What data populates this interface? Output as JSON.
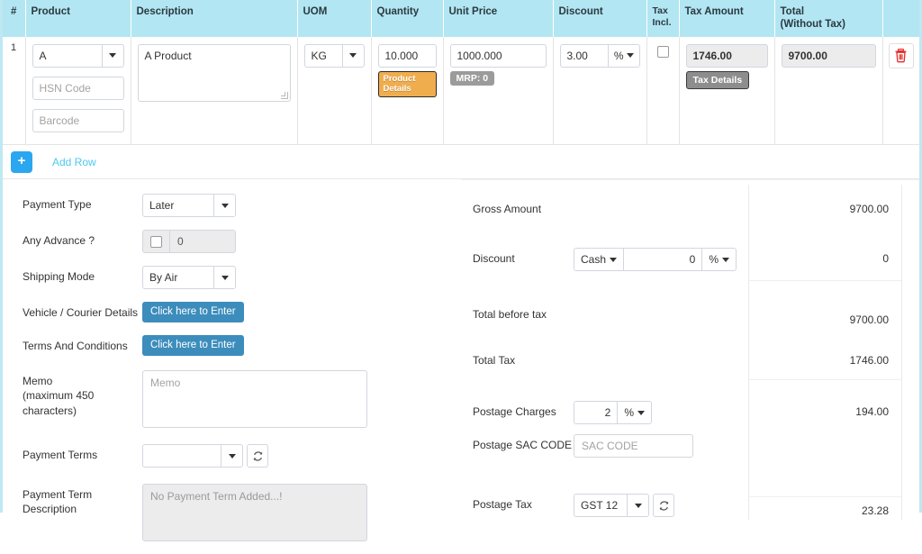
{
  "items_table": {
    "columns": [
      "#",
      "Product",
      "Description",
      "UOM",
      "Quantity",
      "Unit Price",
      "Discount",
      "Tax Incl.",
      "Tax Amount",
      "Total (Without Tax)",
      ""
    ],
    "headers": {
      "index": "#",
      "product": "Product",
      "description": "Description",
      "uom": "UOM",
      "quantity": "Quantity",
      "unit_price": "Unit Price",
      "discount": "Discount",
      "tax_incl_line1": "Tax",
      "tax_incl_line2": "Incl.",
      "tax_amount": "Tax Amount",
      "total_line1": "Total",
      "total_line2": "(Without Tax)"
    },
    "row": {
      "index": "1",
      "product_value": "A",
      "hsn_placeholder": "HSN Code",
      "barcode_placeholder": "Barcode",
      "description_value": "A Product",
      "uom_value": "KG",
      "quantity_value": "10.000",
      "product_details_badge": "Product Details",
      "unit_price_value": "1000.000",
      "mrp_badge": "MRP: 0",
      "discount_value": "3.00",
      "discount_unit": "%",
      "tax_incl_checked": false,
      "tax_amount_value": "1746.00",
      "tax_details_badge": "Tax Details",
      "total_value": "9700.00",
      "delete_icon": "trash-icon"
    }
  },
  "add_row": {
    "plus_label": "+",
    "link_label": "Add Row"
  },
  "left_form": {
    "payment_type": {
      "label": "Payment Type",
      "value": "Later"
    },
    "any_advance": {
      "label": "Any Advance ?",
      "value": "0",
      "checked": false
    },
    "shipping_mode": {
      "label": "Shipping Mode",
      "value": "By Air"
    },
    "vehicle_courier": {
      "label": "Vehicle / Courier Details",
      "button": "Click here to Enter"
    },
    "terms_conditions": {
      "label": "Terms And Conditions",
      "button": "Click here to Enter"
    },
    "memo": {
      "label_line1": "Memo",
      "label_line2": "(maximum 450 characters)",
      "placeholder": "Memo",
      "value": ""
    },
    "payment_terms": {
      "label": "Payment Terms",
      "value": "",
      "refresh_icon": "refresh-icon"
    },
    "payment_term_description": {
      "label": "Payment Term Description",
      "placeholder": "No Payment Term Added...!"
    }
  },
  "summary": {
    "gross_amount": {
      "label": "Gross Amount",
      "value": "9700.00"
    },
    "discount": {
      "label": "Discount",
      "mode": "Cash",
      "amount": "0",
      "unit": "%",
      "value": "0"
    },
    "total_before_tax": {
      "label": "Total before tax",
      "value": "9700.00"
    },
    "total_tax": {
      "label": "Total Tax",
      "value": "1746.00"
    },
    "postage_charges": {
      "label": "Postage Charges",
      "amount": "2",
      "unit": "%",
      "value": "194.00"
    },
    "postage_sac_code": {
      "label": "Postage SAC CODE",
      "placeholder": "SAC CODE",
      "value": ""
    },
    "postage_tax": {
      "label": "Postage Tax",
      "value_select": "GST 12",
      "refresh_icon": "refresh-icon",
      "value": "23.28"
    }
  },
  "colors": {
    "table_header_bg": "#b2e6f2",
    "card_border": "#bfe8f2",
    "primary_blue": "#3c8dbc",
    "add_blue": "#2aa7ef",
    "link_blue": "#4cc9f0",
    "badge_orange": "#f0ad4e",
    "badge_gray": "#9b9b9b",
    "trash_red": "#e12d2d"
  }
}
